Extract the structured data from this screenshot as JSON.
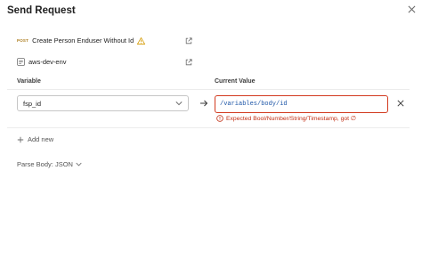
{
  "dialog": {
    "title": "Send Request",
    "close_icon": "close-icon"
  },
  "request": {
    "method": "POST",
    "name": "Create Person Enduser Without Id",
    "warning_icon": "warning-icon",
    "link_icon": "external-link-icon",
    "method_color": "#ab7a1a"
  },
  "environment": {
    "icon": "environment-icon",
    "name": "aws-dev-env",
    "link_icon": "external-link-icon"
  },
  "table": {
    "variable_header": "Variable",
    "value_header": "Current Value"
  },
  "variable_row": {
    "variable": "fsp_id",
    "arrow_icon": "arrow-right-icon",
    "value": "/variables/body/id",
    "error_text": "Expected Bool/Number/String/Timestamp, got ∅",
    "error_color": "#c22f14",
    "remove_icon": "close-icon"
  },
  "actions": {
    "add_new": "Add new",
    "parse_body": "Parse Body: JSON"
  }
}
